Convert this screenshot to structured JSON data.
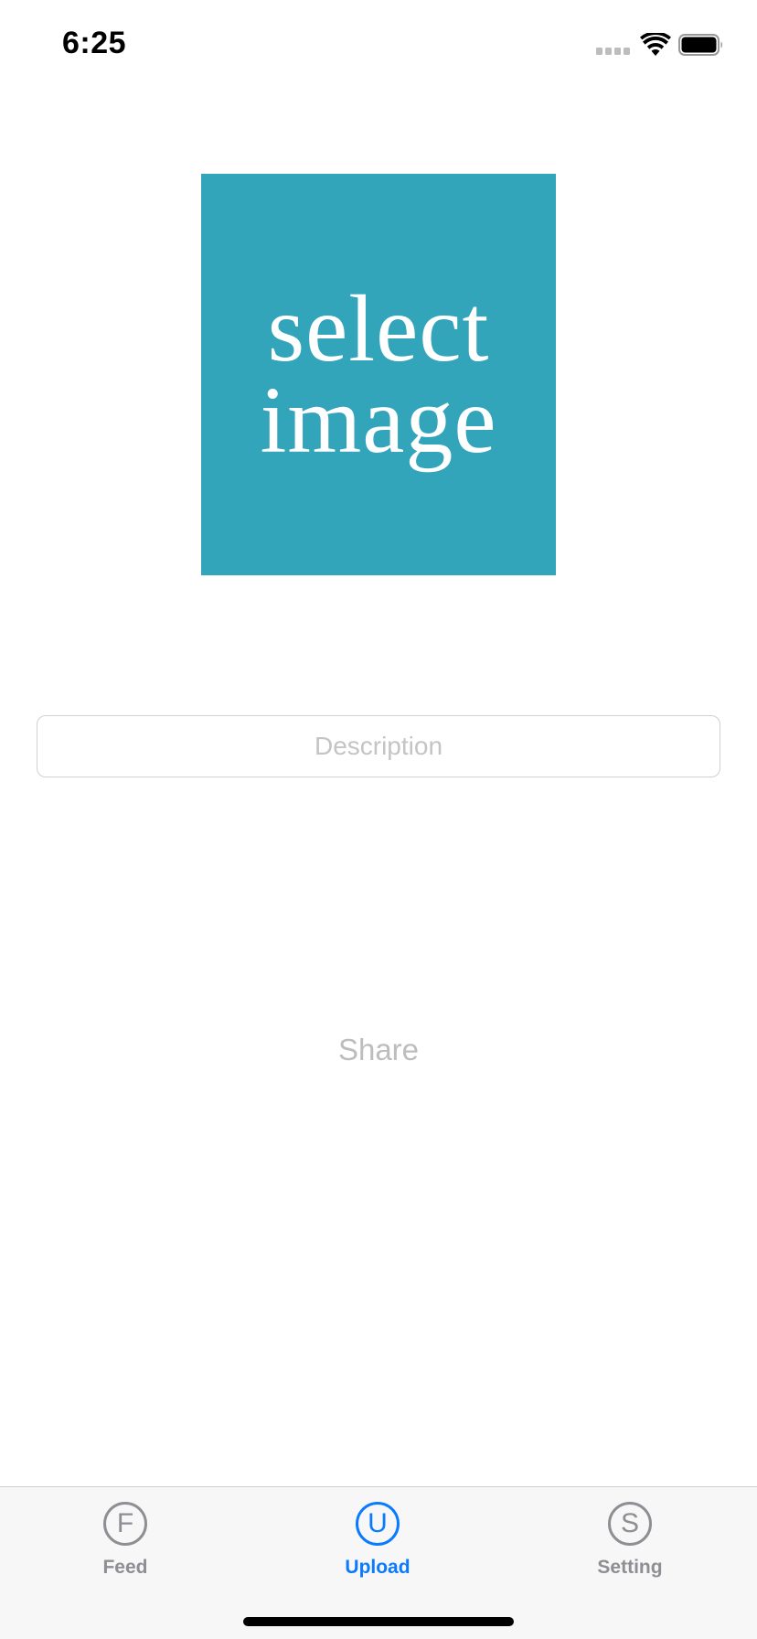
{
  "status_bar": {
    "time": "6:25",
    "signal_icon": "cellular-signal-icon",
    "wifi_icon": "wifi-icon",
    "battery_icon": "battery-full-icon"
  },
  "image_picker": {
    "line1": "select",
    "line2": "image",
    "background_color": "#33a5bb"
  },
  "description": {
    "placeholder": "Description",
    "value": ""
  },
  "share": {
    "label": "Share"
  },
  "tab_bar": {
    "active_color": "#0a7aff",
    "inactive_color": "#8e8e93",
    "items": [
      {
        "letter": "F",
        "label": "Feed",
        "active": false
      },
      {
        "letter": "U",
        "label": "Upload",
        "active": true
      },
      {
        "letter": "S",
        "label": "Setting",
        "active": false
      }
    ]
  }
}
